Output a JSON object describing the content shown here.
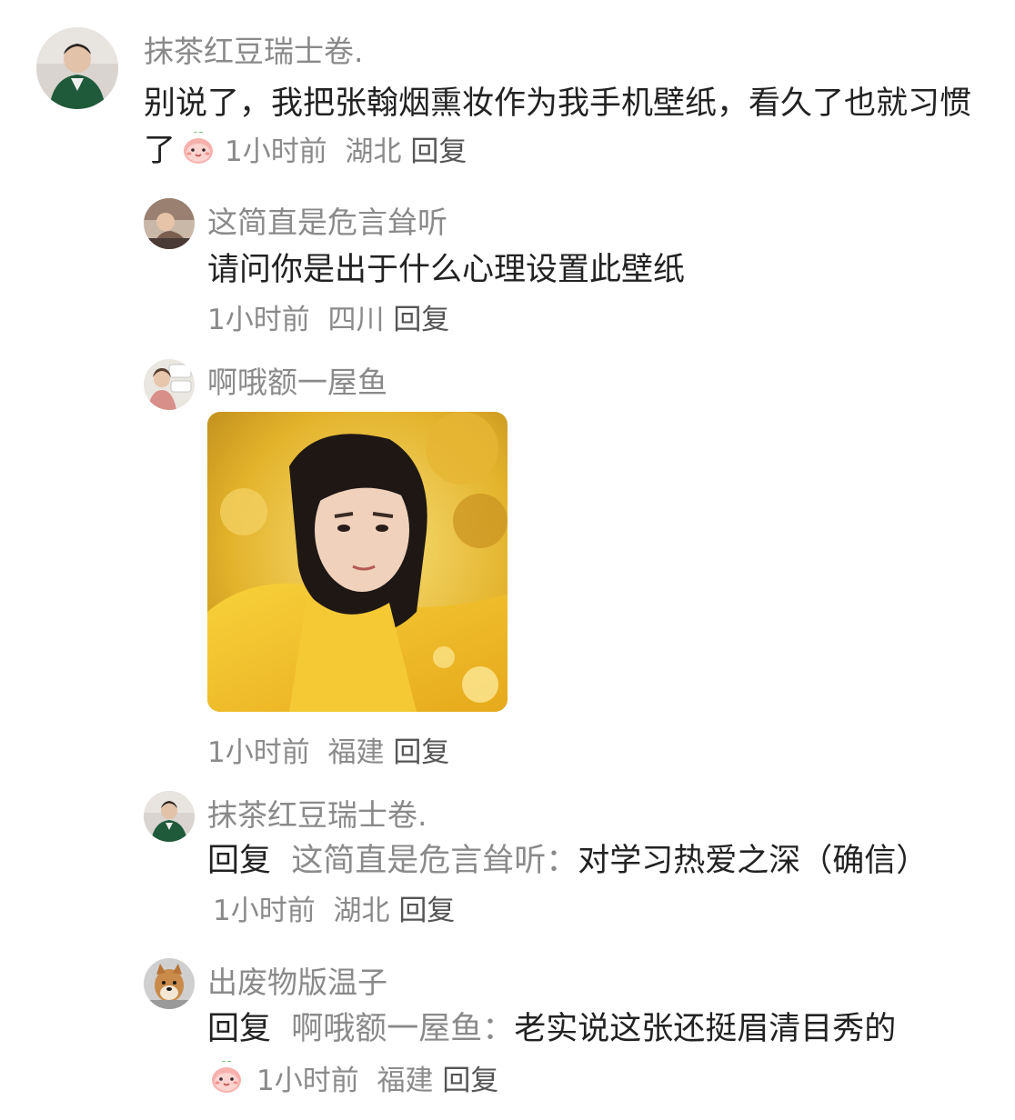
{
  "comments": [
    {
      "username": "抹茶红豆瑞士卷.",
      "text": "别说了，我把张翰烟熏妆作为我手机壁纸，看久了也就习惯了",
      "emoji": "peach-face-emoji",
      "time": "1小时前",
      "location": "湖北",
      "reply_label": "回复"
    }
  ],
  "replies": [
    {
      "username": "这简直是危言耸听",
      "text": "请问你是出于什么心理设置此壁纸",
      "time": "1小时前",
      "location": "四川",
      "reply_label": "回复"
    },
    {
      "username": "啊哦额一屋鱼",
      "image": "yellow-robe-portrait-photo",
      "time": "1小时前",
      "location": "福建",
      "reply_label": "回复"
    },
    {
      "username": "抹茶红豆瑞士卷.",
      "prefix": "回复",
      "target": "这简直是危言耸听：",
      "text": "对学习热爱之深（确信）",
      "time": "1小时前",
      "location": "湖北",
      "reply_label": "回复"
    },
    {
      "username": "出废物版温子",
      "prefix": "回复",
      "target": "啊哦额一屋鱼：",
      "text": "老实说这张还挺眉清目秀的",
      "emoji": "peach-face-emoji",
      "time": "1小时前",
      "location": "福建",
      "reply_label": "回复"
    }
  ],
  "colors": {
    "username": "#8a8a8a",
    "text": "#222222",
    "meta": "#8a8a8a",
    "emoji_pink": "#f6a8a8",
    "emoji_leaf": "#6cc26c"
  }
}
